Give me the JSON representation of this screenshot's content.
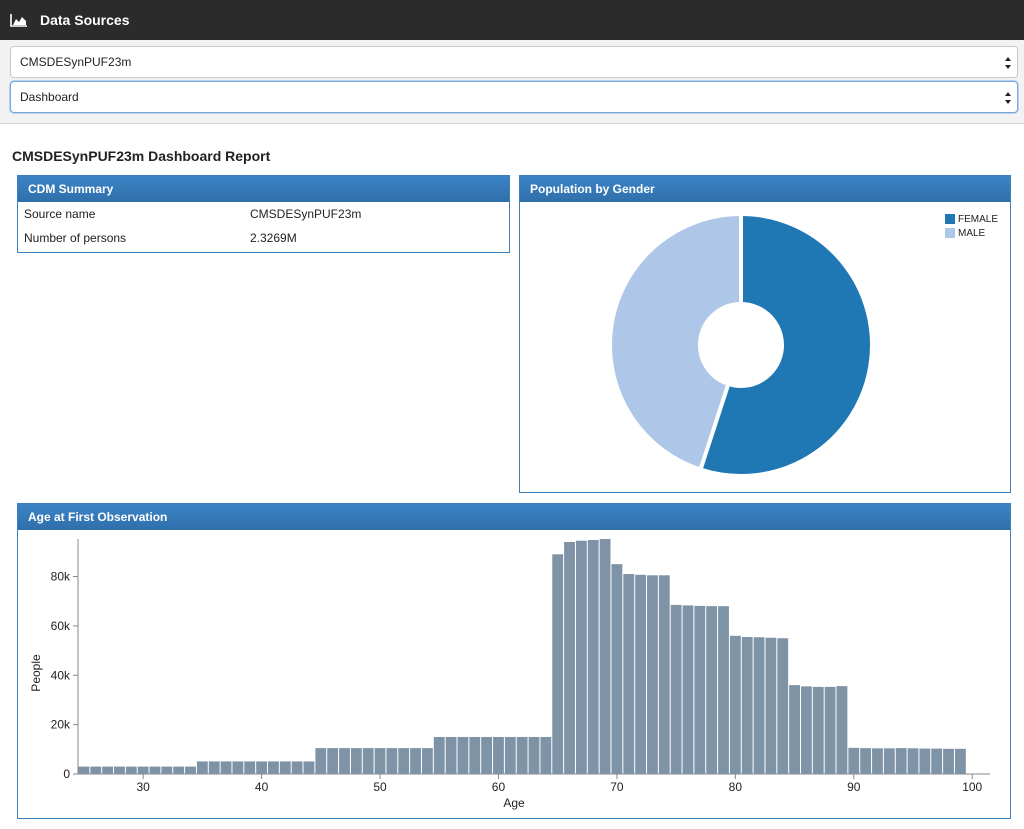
{
  "topbar": {
    "title": "Data Sources",
    "icon": "area-chart-icon"
  },
  "selectors": {
    "source": {
      "value": "CMSDESynPUF23m"
    },
    "report": {
      "value": "Dashboard"
    }
  },
  "report_title": "CMSDESynPUF23m Dashboard Report",
  "cdm_summary": {
    "title": "CDM Summary",
    "rows": [
      {
        "label": "Source name",
        "value": "CMSDESynPUF23m"
      },
      {
        "label": "Number of persons",
        "value": "2.3269M"
      }
    ]
  },
  "gender": {
    "title": "Population by Gender",
    "colors": {
      "FEMALE": "#1f77b4",
      "MALE": "#aec7e8"
    }
  },
  "age": {
    "title": "Age at First Observation",
    "bar_color": "#7f93a6"
  },
  "chart_data": [
    {
      "type": "pie",
      "title": "Population by Gender",
      "labels": [
        "FEMALE",
        "MALE"
      ],
      "values": [
        1280000,
        1046900
      ],
      "legend": "top-right",
      "donut": true
    },
    {
      "type": "bar",
      "title": "Age at First Observation",
      "xlabel": "Age",
      "ylabel": "People",
      "x": [
        25,
        26,
        27,
        28,
        29,
        30,
        31,
        32,
        33,
        34,
        35,
        36,
        37,
        38,
        39,
        40,
        41,
        42,
        43,
        44,
        45,
        46,
        47,
        48,
        49,
        50,
        51,
        52,
        53,
        54,
        55,
        56,
        57,
        58,
        59,
        60,
        61,
        62,
        63,
        64,
        65,
        66,
        67,
        68,
        69,
        70,
        71,
        72,
        73,
        74,
        75,
        76,
        77,
        78,
        79,
        80,
        81,
        82,
        83,
        84,
        85,
        86,
        87,
        88,
        89,
        90,
        91,
        92,
        93,
        94,
        95,
        96,
        97,
        98,
        99,
        100
      ],
      "values": [
        3000,
        3000,
        3000,
        3000,
        3000,
        3000,
        3000,
        3000,
        3000,
        3000,
        5100,
        5100,
        5100,
        5100,
        5100,
        5100,
        5100,
        5100,
        5100,
        5100,
        10500,
        10500,
        10500,
        10500,
        10500,
        10500,
        10500,
        10500,
        10500,
        10500,
        15000,
        15000,
        15000,
        15000,
        15000,
        15000,
        15000,
        15000,
        15000,
        15000,
        89000,
        94000,
        94500,
        94800,
        95200,
        85000,
        81000,
        80700,
        80500,
        80500,
        68500,
        68300,
        68100,
        68000,
        68000,
        56000,
        55500,
        55400,
        55200,
        55000,
        36000,
        35500,
        35300,
        35300,
        35600,
        10600,
        10500,
        10400,
        10400,
        10500,
        10400,
        10300,
        10300,
        10200,
        10200
      ],
      "xticks": [
        30,
        40,
        50,
        60,
        70,
        80,
        90,
        100
      ],
      "yticks": [
        "0",
        "20k",
        "40k",
        "60k",
        "80k"
      ],
      "ylim": [
        0,
        95200
      ],
      "grid": false
    }
  ]
}
